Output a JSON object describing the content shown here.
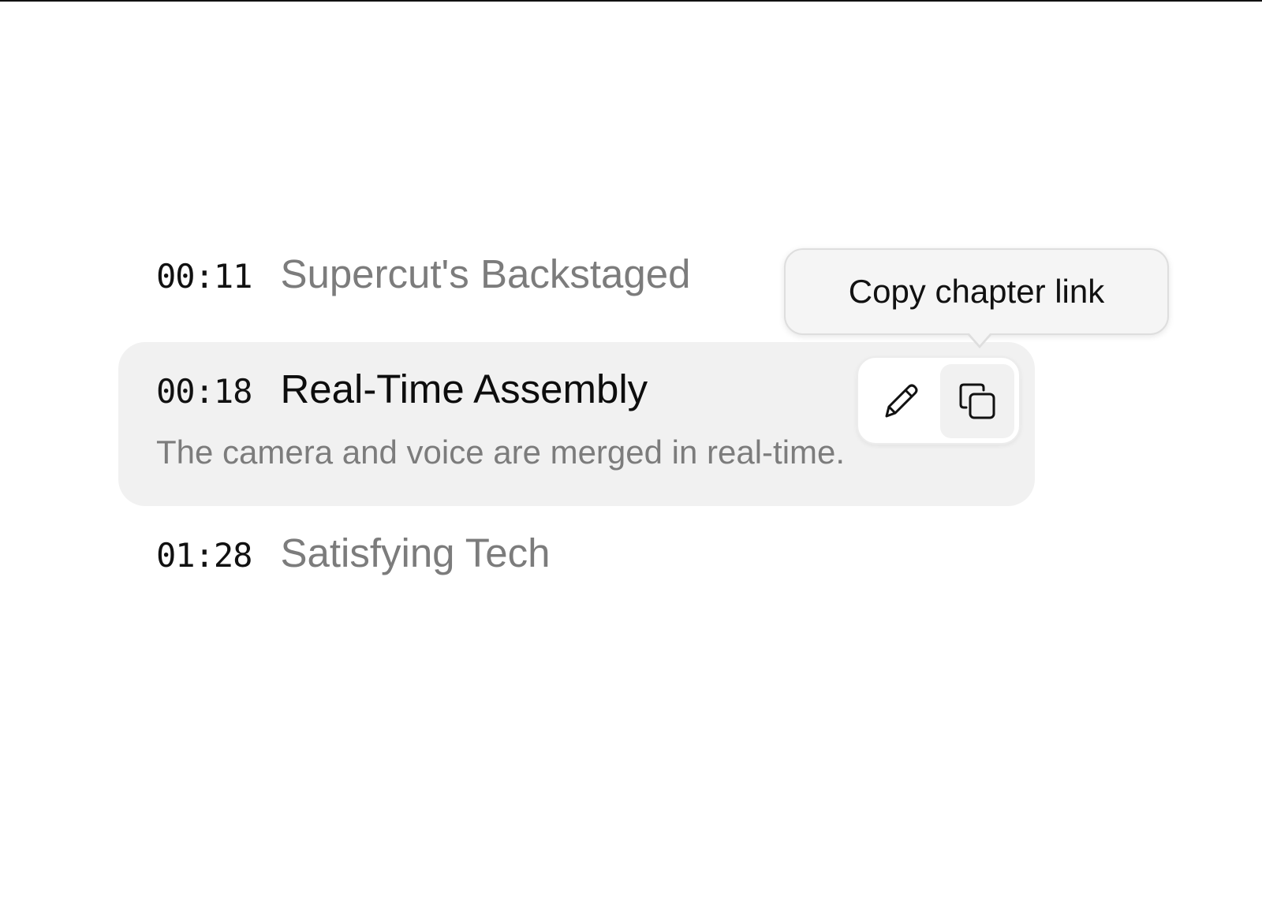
{
  "chapters": [
    {
      "time": "00:11",
      "title": "Supercut's Backstaged"
    },
    {
      "time": "00:18",
      "title": "Real-Time Assembly",
      "description": "The camera and voice are merged in real-time."
    },
    {
      "time": "01:28",
      "title": "Satisfying Tech"
    }
  ],
  "actions": {
    "edit_icon": "pencil-icon",
    "copy_icon": "copy-icon"
  },
  "tooltip": {
    "text": "Copy chapter link"
  },
  "colors": {
    "muted_text": "#7c7c7c",
    "active_card_bg": "#f1f1f1",
    "primary_text": "#111111"
  }
}
